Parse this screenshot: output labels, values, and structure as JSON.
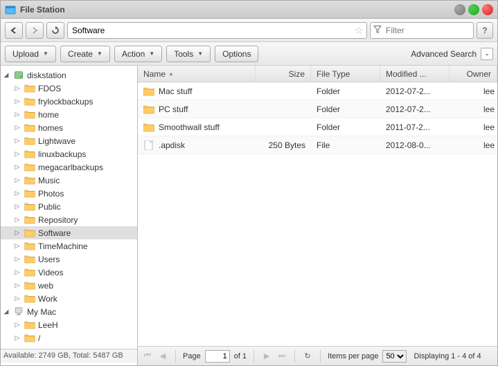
{
  "window": {
    "title": "File Station"
  },
  "toolbar": {
    "path_value": "Software",
    "filter_placeholder": "Filter",
    "help_label": "?",
    "buttons": {
      "upload": "Upload",
      "create": "Create",
      "action": "Action",
      "tools": "Tools",
      "options": "Options"
    },
    "advanced_search": "Advanced Search"
  },
  "sidebar": {
    "roots": [
      {
        "label": "diskstation",
        "icon": "disk",
        "expanded": true,
        "children": [
          {
            "label": "FDOS"
          },
          {
            "label": "frylockbackups"
          },
          {
            "label": "home"
          },
          {
            "label": "homes"
          },
          {
            "label": "Lightwave"
          },
          {
            "label": "linuxbackups"
          },
          {
            "label": "megacarlbackups"
          },
          {
            "label": "Music"
          },
          {
            "label": "Photos"
          },
          {
            "label": "Public"
          },
          {
            "label": "Repository"
          },
          {
            "label": "Software",
            "selected": true
          },
          {
            "label": "TimeMachine"
          },
          {
            "label": "Users"
          },
          {
            "label": "Videos"
          },
          {
            "label": "web"
          },
          {
            "label": "Work"
          }
        ]
      },
      {
        "label": "My Mac",
        "icon": "mac",
        "expanded": true,
        "children": [
          {
            "label": "LeeH"
          },
          {
            "label": "/"
          }
        ]
      }
    ],
    "status": "Available: 2749 GB, Total: 5487 GB"
  },
  "grid": {
    "columns": {
      "name": "Name",
      "size": "Size",
      "type": "File Type",
      "modified": "Modified ...",
      "owner": "Owner"
    },
    "rows": [
      {
        "icon": "folder",
        "name": "Mac stuff",
        "size": "",
        "type": "Folder",
        "modified": "2012-07-2...",
        "owner": "lee"
      },
      {
        "icon": "folder",
        "name": "PC stuff",
        "size": "",
        "type": "Folder",
        "modified": "2012-07-2...",
        "owner": "lee"
      },
      {
        "icon": "folder",
        "name": "Smoothwall stuff",
        "size": "",
        "type": "Folder",
        "modified": "2011-07-2...",
        "owner": "lee"
      },
      {
        "icon": "file",
        "name": ".apdisk",
        "size": "250 Bytes",
        "type": "File",
        "modified": "2012-08-0...",
        "owner": "lee"
      }
    ]
  },
  "pager": {
    "page_label": "Page",
    "page_value": "1",
    "of_label": "of 1",
    "ipp_label": "Items per page",
    "ipp_value": "50",
    "status": "Displaying 1 - 4 of 4"
  }
}
